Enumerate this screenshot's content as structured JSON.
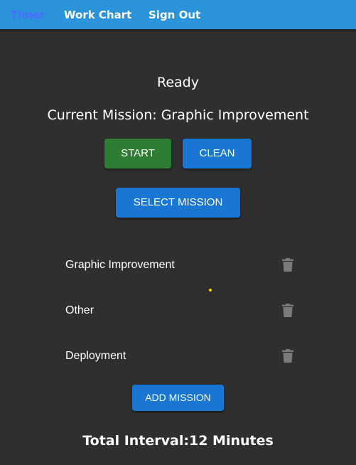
{
  "nav": {
    "timer": "Timer",
    "work_chart": "Work Chart",
    "sign_out": "Sign Out"
  },
  "timer": {
    "status": "Ready",
    "current_mission": "Current Mission: Graphic Improvement"
  },
  "buttons": {
    "start": "START",
    "clean": "CLEAN",
    "select_mission": "SELECT MISSION",
    "add_mission": "ADD MISSION"
  },
  "missions": [
    {
      "label": "Graphic Improvement"
    },
    {
      "label": "Other"
    },
    {
      "label": "Deployment"
    }
  ],
  "total": "Total Interval:12 Minutes",
  "colors": {
    "topbar": "#2b93d9",
    "active_nav": "#4a6dff",
    "background": "#2f2f2f",
    "start_button": "#2e7d32",
    "primary_button": "#1976d2",
    "trash_icon": "#7a7a7a",
    "cursor_dot": "#f2d600"
  }
}
